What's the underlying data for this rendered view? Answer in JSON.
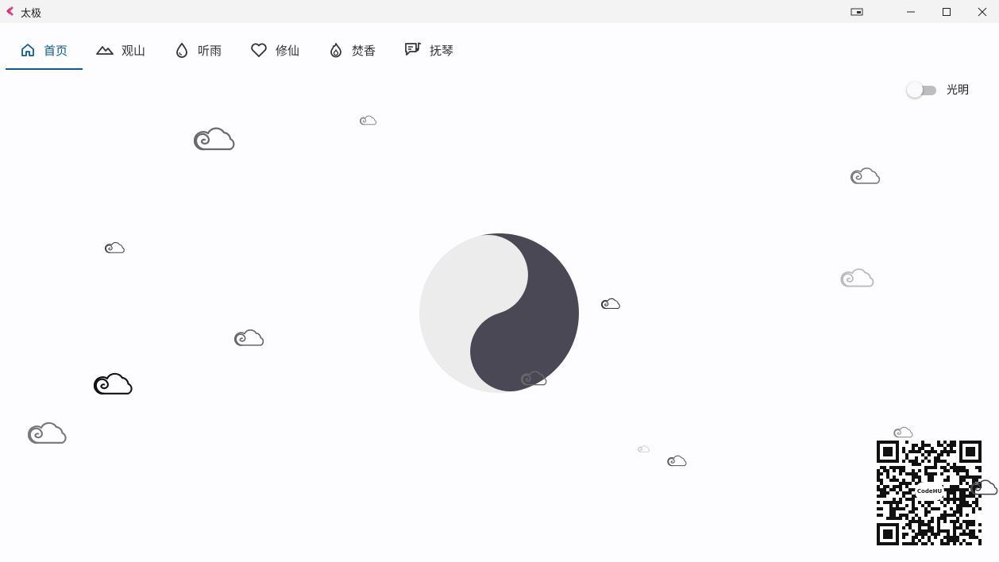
{
  "window": {
    "title": "太极",
    "controls": [
      "pip-icon",
      "minimize-icon",
      "maximize-icon",
      "close-icon"
    ]
  },
  "nav": {
    "active_index": 0,
    "accent_color": "#0f5a96",
    "tabs": [
      {
        "label": "首页",
        "icon": "home-icon"
      },
      {
        "label": "观山",
        "icon": "mountain-icon"
      },
      {
        "label": "听雨",
        "icon": "water-drop-icon"
      },
      {
        "label": "修仙",
        "icon": "heart-icon"
      },
      {
        "label": "焚香",
        "icon": "flame-icon"
      },
      {
        "label": "抚琴",
        "icon": "music-note-icon"
      }
    ]
  },
  "theme_toggle": {
    "label": "光明",
    "on": false
  },
  "center": {
    "symbol": "taiji-yin-yang",
    "dark_color": "#4b4856",
    "light_color": "#ececec"
  },
  "decor": {
    "cloud_icon": "cloud-icon",
    "qr": {
      "logo_text": "CodeHU"
    }
  }
}
